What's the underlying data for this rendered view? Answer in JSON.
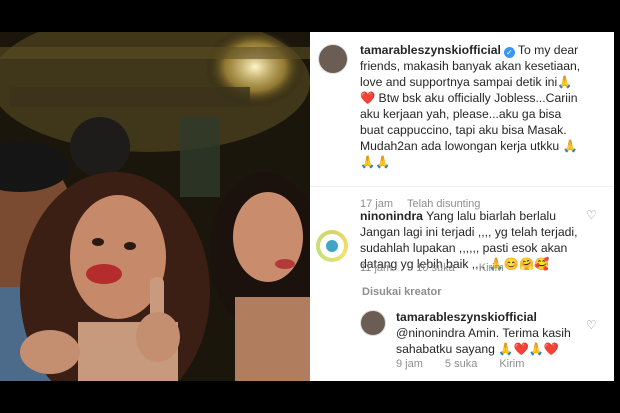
{
  "post": {
    "username": "tamarableszynskiofficial",
    "caption_lines": [
      "To my dear",
      "friends, makasih banyak akan kesetiaan,",
      "love and supportnya sampai detik ini🙏",
      "❤️ Btw bsk aku officially Jobless...Cariin",
      "aku kerjaan yah, please...aku ga bisa",
      "buat cappuccino, tapi aku bisa Masak.",
      "Mudah2an ada lowongan kerja utkku 🙏",
      "🙏🙏"
    ],
    "time": "17 jam",
    "edited": "Telah disunting"
  },
  "comment1": {
    "username": "ninonindra",
    "lines": [
      "Yang lalu biarlah berlalu",
      "Jangan lagi ini terjadi ,,,, yg telah terjadi,",
      "sudahlah lupakan ,,,,,, pasti esok akan",
      "datang yg  lebih baik ,,,, 🙏😊🤗🥰"
    ],
    "time": "11 jam",
    "likes": "10 suka",
    "reply": "Kirim"
  },
  "liked_by_creator": "Disukai kreator",
  "reply1": {
    "username": "tamarableszynskiofficial",
    "lines": [
      "@ninonindra Amin. Terima kasih",
      "sahabatku sayang 🙏❤️🙏❤️"
    ],
    "time": "9 jam",
    "likes": "5 suka",
    "reply": "Kirim"
  },
  "icons": {
    "verified": "verified-badge-icon",
    "heart": "heart-outline-icon"
  },
  "colors": {
    "verified": "#3897f0",
    "meta": "#8e8e8e",
    "text": "#262626"
  }
}
